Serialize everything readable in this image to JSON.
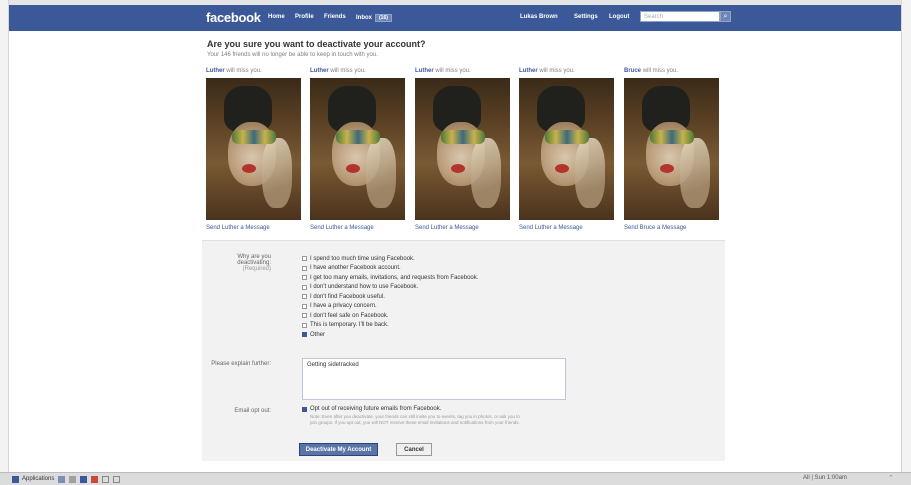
{
  "header": {
    "logo": "facebook",
    "nav": [
      "Home",
      "Profile",
      "Friends",
      "Inbox"
    ],
    "inbox_count": "(16)",
    "account_nav": [
      "Lukas Brown",
      "Settings",
      "Logout"
    ],
    "search_placeholder": "Search",
    "brand_color": "#3b5998"
  },
  "page": {
    "title": "Are you sure you want to deactivate your account?",
    "subtitle": "Your 146 friends will no longer be able to keep in touch with you."
  },
  "friends": [
    {
      "name": "Luther",
      "caption_suffix": "will miss you.",
      "link": "Send Luther a Message"
    },
    {
      "name": "Luther",
      "caption_suffix": "will miss you.",
      "link": "Send Luther a Message"
    },
    {
      "name": "Luther",
      "caption_suffix": "will miss you.",
      "link": "Send Luther a Message"
    },
    {
      "name": "Luther",
      "caption_suffix": "will miss you.",
      "link": "Send Luther a Message"
    },
    {
      "name": "Bruce",
      "caption_suffix": "will miss you.",
      "link": "Send Bruce a Message"
    }
  ],
  "form": {
    "reason_label": "Why are you deactivating:",
    "reason_required": "(Required)",
    "reasons": [
      {
        "label": "I spend too much time using Facebook.",
        "checked": false
      },
      {
        "label": "I have another Facebook account.",
        "checked": false
      },
      {
        "label": "I get too many emails, invitations, and requests from Facebook.",
        "checked": false
      },
      {
        "label": "I don't understand how to use Facebook.",
        "checked": false
      },
      {
        "label": "I don't find Facebook useful.",
        "checked": false
      },
      {
        "label": "I have a privacy concern.",
        "checked": false
      },
      {
        "label": "I don't feel safe on Facebook.",
        "checked": false
      },
      {
        "label": "This is temporary. I'll be back.",
        "checked": false
      },
      {
        "label": "Other",
        "checked": true
      }
    ],
    "explain_label": "Please explain further:",
    "explain_value": "Getting sidetracked",
    "optout_label": "Email opt out:",
    "optout_title": "Opt out of receiving future emails from Facebook.",
    "optout_checked": true,
    "optout_desc": "Note: Even after you deactivate, your friends can still invite you to events, tag you in photos, or ask you to join groups. If you opt out, you will NOT receive these email invitations and notifications from your friends.",
    "deactivate_label": "Deactivate My Account",
    "cancel_label": "Cancel"
  },
  "taskbar": {
    "start_label": "Applications",
    "clock": "All | Sun 1:00am"
  }
}
